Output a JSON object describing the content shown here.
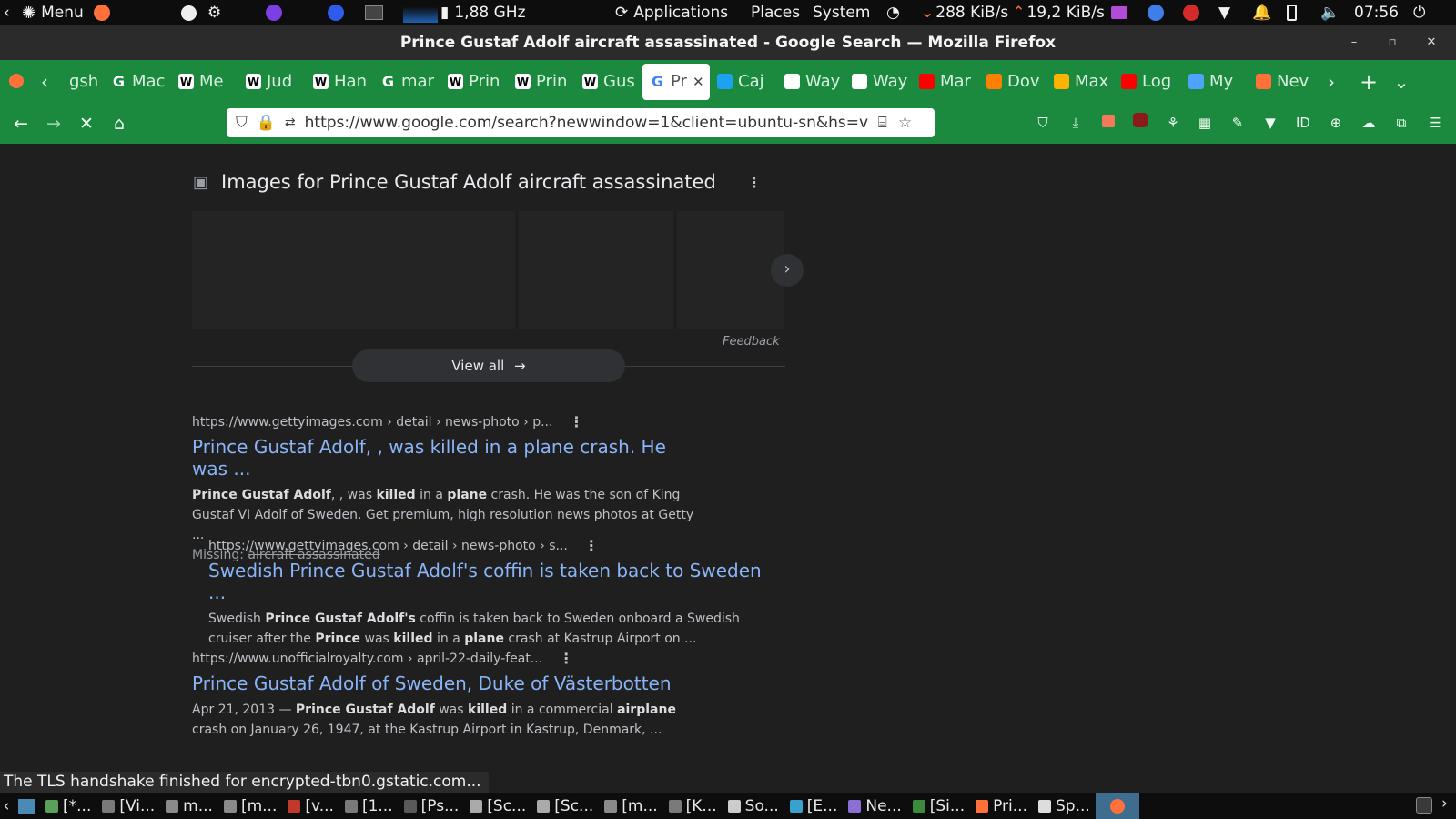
{
  "system_panel": {
    "menu_label": "Menu",
    "cpu_freq": "1,88 GHz",
    "menus": [
      "Applications",
      "Places",
      "System"
    ],
    "net_down": "288 KiB/s",
    "net_up": "19,2 KiB/s",
    "clock": "07:56"
  },
  "window": {
    "title": "Prince Gustaf Adolf aircraft assassinated - Google Search — Mozilla Firefox"
  },
  "tabs": [
    {
      "label": "gsh",
      "icon": "partial-tab",
      "color": "#1c8a3e"
    },
    {
      "label": "Mac",
      "icon": "google-icon",
      "color": "#4285f4"
    },
    {
      "label": "Me",
      "icon": "wikipedia-icon",
      "color": "#ffffff"
    },
    {
      "label": "Jud",
      "icon": "wikipedia-icon",
      "color": "#ffffff"
    },
    {
      "label": "Han",
      "icon": "wikipedia-icon",
      "color": "#ffffff"
    },
    {
      "label": "mar",
      "icon": "google-icon",
      "color": "#4285f4"
    },
    {
      "label": "Prin",
      "icon": "wikipedia-icon",
      "color": "#ffffff"
    },
    {
      "label": "Prin",
      "icon": "wikipedia-icon",
      "color": "#ffffff"
    },
    {
      "label": "Gus",
      "icon": "wikipedia-icon",
      "color": "#ffffff"
    },
    {
      "label": "Pr",
      "icon": "google-icon",
      "color": "#4285f4",
      "active": true
    },
    {
      "label": "Caj",
      "icon": "twitter-icon",
      "color": "#1da1f2"
    },
    {
      "label": "Way",
      "icon": "archive-icon",
      "color": "#ffffff"
    },
    {
      "label": "Way",
      "icon": "archive-icon",
      "color": "#ffffff"
    },
    {
      "label": "Mar",
      "icon": "youtube-icon",
      "color": "#ff0000"
    },
    {
      "label": "Dov",
      "icon": "blogger-icon",
      "color": "#ff8000"
    },
    {
      "label": "Max",
      "icon": "diamond-icon",
      "color": "#ffb300"
    },
    {
      "label": "Log",
      "icon": "youtube-icon",
      "color": "#ff0000"
    },
    {
      "label": "My",
      "icon": "search-icon",
      "color": "#4fa3ff"
    },
    {
      "label": "Nev",
      "icon": "firefox-icon",
      "color": "#ff7139"
    }
  ],
  "url": "https://www.google.com/search?newwindow=1&client=ubuntu-sn&hs=v",
  "images_section": {
    "heading": "Images for Prince Gustaf Adolf aircraft assassinated",
    "feedback": "Feedback",
    "view_all": "View all"
  },
  "results": [
    {
      "cite": "https://www.gettyimages.com › detail › news-photo › p...",
      "title": "Prince Gustaf Adolf, , was killed in a plane crash. He was ...",
      "snippet_html": "<b>Prince Gustaf Adolf</b>, , was <b>killed</b> in a <b>plane</b> crash. He was the son of King Gustaf VI Adolf of Sweden. Get premium, high resolution news photos at Getty ...",
      "missing_label": "Missing:",
      "missing_terms": "aircraft assassinated"
    },
    {
      "cite": "https://www.gettyimages.com › detail › news-photo › s...",
      "title": "Swedish Prince Gustaf Adolf's coffin is taken back to Sweden ...",
      "snippet_html": "Swedish <b>Prince Gustaf Adolf's</b> coffin is taken back to Sweden onboard a Swedish cruiser after the <b>Prince</b> was <b>killed</b> in a <b>plane</b> crash at Kastrup Airport on ..."
    },
    {
      "cite": "https://www.unofficialroyalty.com › april-22-daily-feat...",
      "title": "Prince Gustaf Adolf of Sweden, Duke of Västerbotten",
      "snippet_html": "Apr 21, 2013 — <b>Prince Gustaf Adolf</b> was <b>killed</b> in a commercial <b>airplane</b> crash on January 26, 1947, at the Kastrup Airport in Kastrup, Denmark, ..."
    }
  ],
  "status_message": "The TLS handshake finished for encrypted-tbn0.gstatic.com...",
  "taskbar": [
    {
      "label": "[*..."
    },
    {
      "label": "[Vi..."
    },
    {
      "label": "m..."
    },
    {
      "label": "[m..."
    },
    {
      "label": "[v..."
    },
    {
      "label": "[1..."
    },
    {
      "label": "[Ps..."
    },
    {
      "label": "[Sc..."
    },
    {
      "label": "[Sc..."
    },
    {
      "label": "[m..."
    },
    {
      "label": "[K..."
    },
    {
      "label": "So..."
    },
    {
      "label": "[E..."
    },
    {
      "label": "Ne..."
    },
    {
      "label": "[Si..."
    },
    {
      "label": "Pri..."
    },
    {
      "label": "Sp..."
    },
    {
      "label": "",
      "active": true
    }
  ]
}
